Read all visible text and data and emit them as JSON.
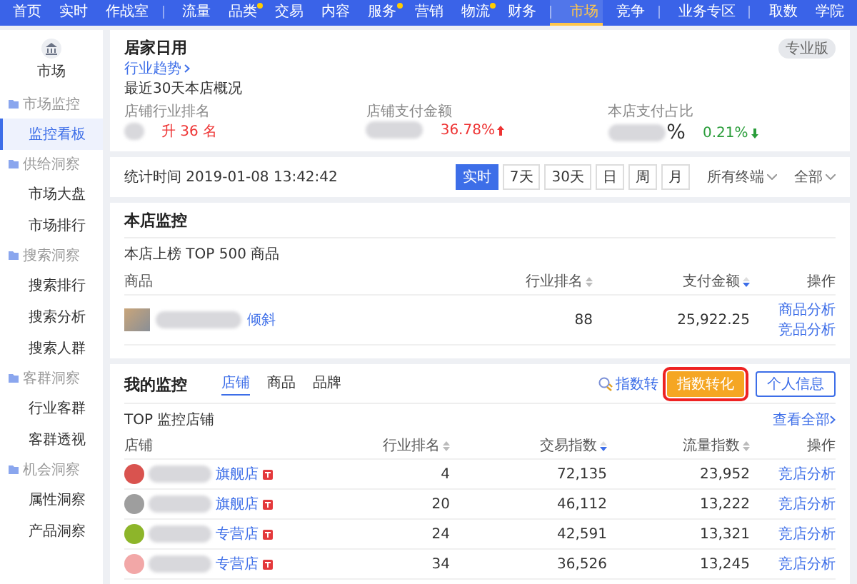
{
  "nav": {
    "items": [
      {
        "label": "首页",
        "selected": false,
        "dot": false,
        "separator_before": false
      },
      {
        "label": "实时",
        "selected": false,
        "dot": false,
        "separator_before": false
      },
      {
        "label": "作战室",
        "selected": false,
        "dot": false,
        "separator_before": false
      },
      {
        "label": "流量",
        "selected": false,
        "dot": false,
        "separator_before": true
      },
      {
        "label": "品类",
        "selected": false,
        "dot": true,
        "separator_before": false
      },
      {
        "label": "交易",
        "selected": false,
        "dot": false,
        "separator_before": false
      },
      {
        "label": "内容",
        "selected": false,
        "dot": false,
        "separator_before": false
      },
      {
        "label": "服务",
        "selected": false,
        "dot": true,
        "separator_before": false
      },
      {
        "label": "营销",
        "selected": false,
        "dot": false,
        "separator_before": false
      },
      {
        "label": "物流",
        "selected": false,
        "dot": true,
        "separator_before": false
      },
      {
        "label": "财务",
        "selected": false,
        "dot": false,
        "separator_before": false
      },
      {
        "label": "市场",
        "selected": true,
        "dot": false,
        "separator_before": true
      },
      {
        "label": "竞争",
        "selected": false,
        "dot": false,
        "separator_before": false
      },
      {
        "label": "业务专区",
        "selected": false,
        "dot": false,
        "separator_before": true
      },
      {
        "label": "取数",
        "selected": false,
        "dot": false,
        "separator_before": true
      },
      {
        "label": "学院",
        "selected": false,
        "dot": false,
        "separator_before": false
      }
    ]
  },
  "sidebar": {
    "title": "市场",
    "groups": [
      {
        "label": "市场监控",
        "items": [
          {
            "label": "监控看板",
            "selected": true
          }
        ]
      },
      {
        "label": "供给洞察",
        "items": [
          {
            "label": "市场大盘",
            "selected": false
          },
          {
            "label": "市场排行",
            "selected": false
          }
        ]
      },
      {
        "label": "搜索洞察",
        "items": [
          {
            "label": "搜索排行",
            "selected": false
          },
          {
            "label": "搜索分析",
            "selected": false
          },
          {
            "label": "搜索人群",
            "selected": false
          }
        ]
      },
      {
        "label": "客群洞察",
        "items": [
          {
            "label": "行业客群",
            "selected": false
          },
          {
            "label": "客群透视",
            "selected": false
          }
        ]
      },
      {
        "label": "机会洞察",
        "items": [
          {
            "label": "属性洞察",
            "selected": false
          },
          {
            "label": "产品洞察",
            "selected": false
          }
        ]
      }
    ]
  },
  "overview": {
    "title": "居家日用",
    "badge": "专业版",
    "link": "行业趋势",
    "period": "最近30天本店概况",
    "metrics": [
      {
        "label": "店铺行业排名",
        "change": "升 36 名",
        "rising": true,
        "arrow": false
      },
      {
        "label": "店铺支付金额",
        "change": "36.78%",
        "rising": true,
        "arrow": true
      },
      {
        "label": "本店支付占比",
        "suffix": "%",
        "change": "0.21%",
        "rising": false,
        "arrow": true
      }
    ]
  },
  "filter": {
    "time": "统计时间 2019-01-08 13:42:42",
    "ranges": [
      {
        "label": "实时",
        "selected": true
      },
      {
        "label": "7天",
        "selected": false
      },
      {
        "label": "30天",
        "selected": false
      },
      {
        "label": "日",
        "selected": false
      },
      {
        "label": "周",
        "selected": false
      },
      {
        "label": "月",
        "selected": false
      }
    ],
    "dropdowns": [
      "所有终端",
      "全部"
    ]
  },
  "store_monitor": {
    "title": "本店监控",
    "subtitle": "本店上榜 TOP 500 商品",
    "columns": [
      {
        "label": "商品",
        "sortable": false,
        "sorted": false
      },
      {
        "label": "行业排名",
        "sortable": true,
        "sorted": false
      },
      {
        "label": "支付金额",
        "sortable": true,
        "sorted": true
      },
      {
        "label": "操作",
        "sortable": false,
        "sorted": false
      }
    ],
    "rows": [
      {
        "name_tail": "倾斜",
        "rank": "88",
        "amount": "25,922.25",
        "actions": [
          "商品分析",
          "竞品分析"
        ]
      }
    ]
  },
  "my_monitor": {
    "title": "我的监控",
    "tabs": [
      {
        "label": "店铺",
        "selected": true
      },
      {
        "label": "商品",
        "selected": false
      },
      {
        "label": "品牌",
        "selected": false
      }
    ],
    "index_link": "指数转",
    "primary_button": "指数转化",
    "secondary_button": "个人信息",
    "subtitle": "TOP 监控店铺",
    "view_all": "查看全部",
    "columns": [
      {
        "label": "店铺",
        "sortable": false,
        "sorted": false
      },
      {
        "label": "行业排名",
        "sortable": true,
        "sorted": false
      },
      {
        "label": "交易指数",
        "sortable": true,
        "sorted": true
      },
      {
        "label": "流量指数",
        "sortable": true,
        "sorted": false
      },
      {
        "label": "操作",
        "sortable": false,
        "sorted": false
      }
    ],
    "rows": [
      {
        "name_tail": "旗舰店",
        "color": "#d9534f",
        "rank": "4",
        "trade": "72,135",
        "traffic": "23,952",
        "action": "竞店分析"
      },
      {
        "name_tail": "旗舰店",
        "color": "#9e9e9e",
        "rank": "20",
        "trade": "46,112",
        "traffic": "13,222",
        "action": "竞店分析"
      },
      {
        "name_tail": "专营店",
        "color": "#8db52a",
        "rank": "24",
        "trade": "42,591",
        "traffic": "13,321",
        "action": "竞店分析"
      },
      {
        "name_tail": "专营店",
        "color": "#f2a7a7",
        "rank": "34",
        "trade": "36,526",
        "traffic": "13,245",
        "action": "竞店分析"
      }
    ]
  }
}
